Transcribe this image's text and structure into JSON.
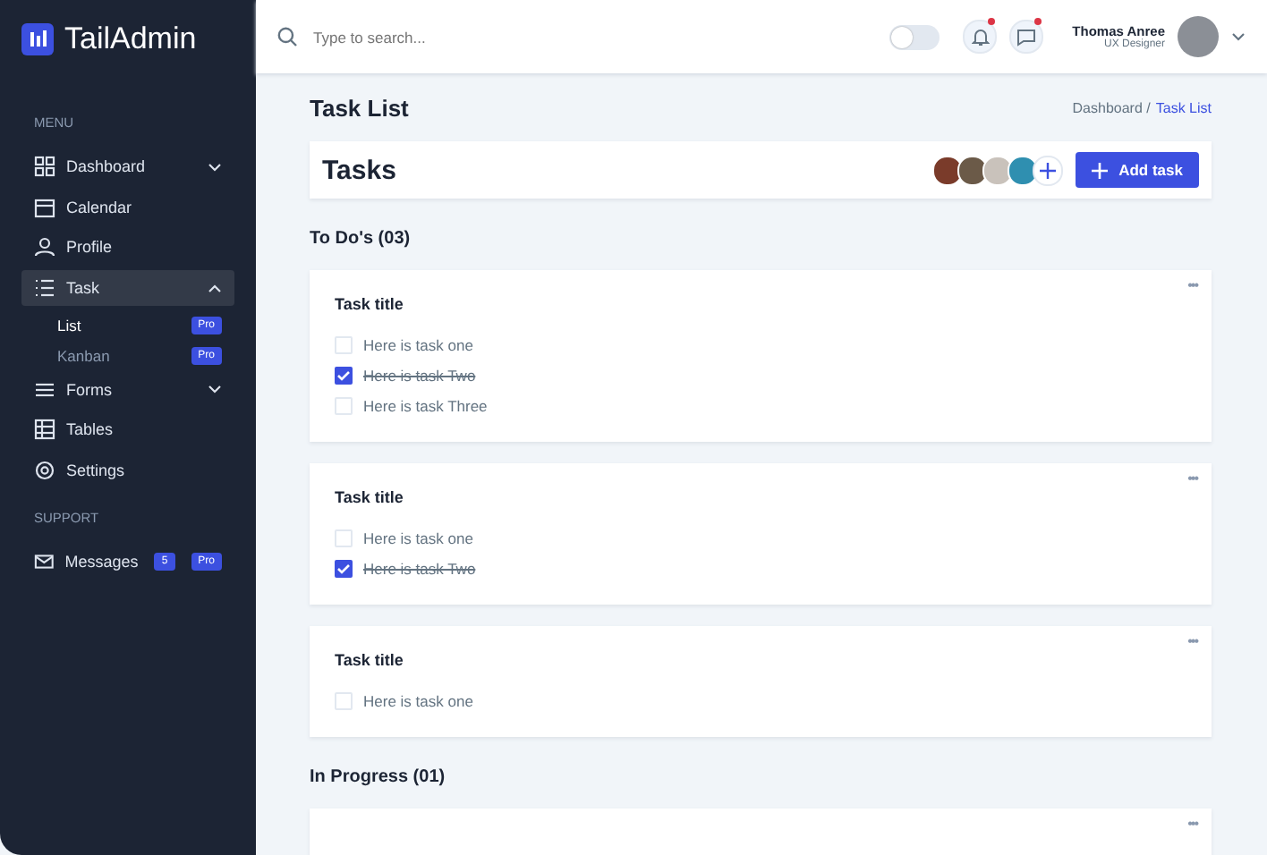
{
  "sidebar": {
    "logo": "TailAdmin",
    "groups": [
      {
        "title": "MENU",
        "items": [
          {
            "label": "Dashboard",
            "expanded": false,
            "selected": false
          },
          {
            "label": "Calendar",
            "selected": false
          },
          {
            "label": "Profile",
            "selected": false
          },
          {
            "label": "Task",
            "expanded": true,
            "selected": true,
            "children": [
              {
                "label": "List",
                "selected": true,
                "badges": [
                  "Pro"
                ]
              },
              {
                "label": "Kanban",
                "selected": false,
                "badges": [
                  "Pro"
                ]
              }
            ]
          },
          {
            "label": "Forms",
            "expanded": false,
            "selected": false
          },
          {
            "label": "Tables",
            "selected": false
          },
          {
            "label": "Settings",
            "selected": false
          }
        ]
      },
      {
        "title": "SUPPORT",
        "items": [
          {
            "label": "Messages",
            "selected": false,
            "badges": [
              "5",
              "Pro"
            ]
          }
        ]
      }
    ]
  },
  "header": {
    "search": {
      "placeholder": "Type to search..."
    },
    "dark_mode": {
      "on": false
    },
    "notifications": {
      "unread": true
    },
    "messages": {
      "unread": true
    },
    "user": {
      "name": "Thomas Anree",
      "role": "UX Designer"
    }
  },
  "page": {
    "title": "Task List",
    "breadcrumb": [
      {
        "label": "Dashboard /",
        "selected": false
      },
      {
        "label": "Task List",
        "selected": true
      }
    ],
    "toolbar": {
      "title": "Tasks",
      "add_button": "Add task"
    },
    "sections": [
      {
        "title": "To Do's (03)",
        "cards": [
          {
            "menu": "•••",
            "title": "Task title",
            "tasks": [
              {
                "label": "Here is task one",
                "checked": false
              },
              {
                "label": "Here is task Two",
                "checked": true
              },
              {
                "label": "Here is task Three",
                "checked": false
              }
            ]
          },
          {
            "menu": "•••",
            "title": "Task title",
            "tasks": [
              {
                "label": "Here is task one",
                "checked": false
              },
              {
                "label": "Here is task Two",
                "checked": true
              }
            ]
          },
          {
            "menu": "•••",
            "title": "Task title",
            "tasks": [
              {
                "label": "Here is task one",
                "checked": false
              }
            ]
          }
        ]
      },
      {
        "title": "In Progress (01)",
        "cards": [
          {
            "menu": "•••"
          }
        ]
      }
    ]
  }
}
